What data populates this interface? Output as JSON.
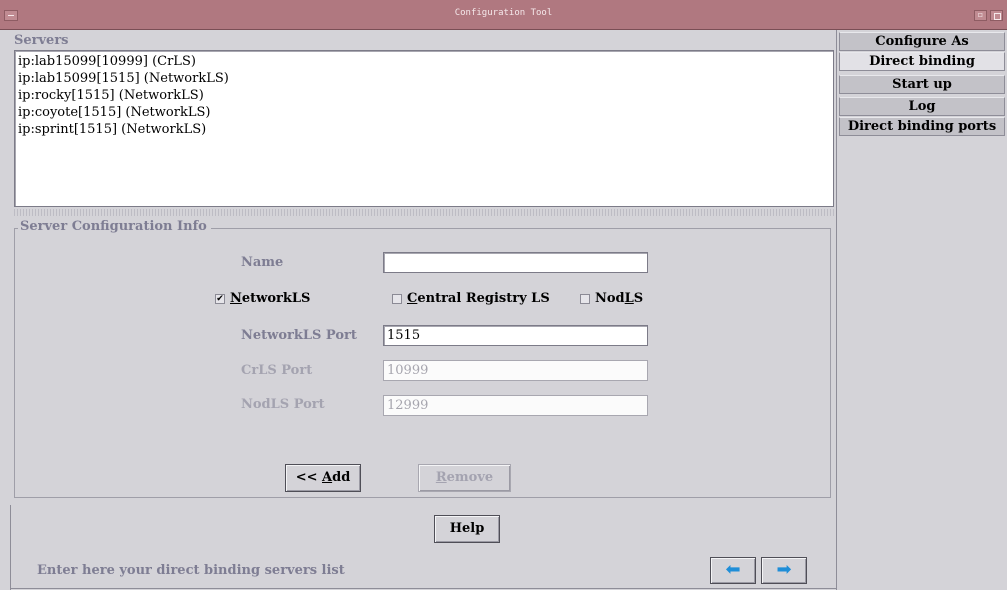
{
  "window": {
    "title": "Configuration Tool"
  },
  "servers": {
    "label": "Servers",
    "items": [
      "ip:lab15099[10999] (CrLS)",
      "ip:lab15099[1515] (NetworkLS)",
      "ip:rocky[1515] (NetworkLS)",
      "ip:coyote[1515] (NetworkLS)",
      "ip:sprint[1515] (NetworkLS)"
    ]
  },
  "config": {
    "legend": "Server Configuration Info",
    "name_label": "Name",
    "name_value": "",
    "networkls_check": {
      "pre": "",
      "underline": "N",
      "post": "etworkLS",
      "checked": true,
      "mark": "✔"
    },
    "crls_check": {
      "pre": "",
      "underline": "C",
      "post": "entral Registry LS",
      "checked": false,
      "mark": ""
    },
    "nodls_check": {
      "pre": "Nod",
      "underline": "L",
      "post": "S",
      "checked": false,
      "mark": ""
    },
    "networkls_port_label": "NetworkLS Port",
    "networkls_port_value": "1515",
    "crls_port_label": "CrLS Port",
    "crls_port_value": "10999",
    "nodls_port_label": "NodLS Port",
    "nodls_port_value": "12999",
    "add_button": {
      "pre": "<< ",
      "underline": "A",
      "post": "dd"
    },
    "remove_button": {
      "pre": "",
      "underline": "R",
      "post": "emove"
    }
  },
  "help_button": "Help",
  "status_text": "Enter here your direct binding servers list",
  "nav": {
    "back_glyph": "⬅",
    "next_glyph": "➡"
  },
  "accent_color": "#1f8ed8",
  "sidebar": {
    "tabs": [
      "Configure As",
      "Direct binding",
      "Start up",
      "Log",
      "Direct binding ports"
    ],
    "active_index": 1
  }
}
